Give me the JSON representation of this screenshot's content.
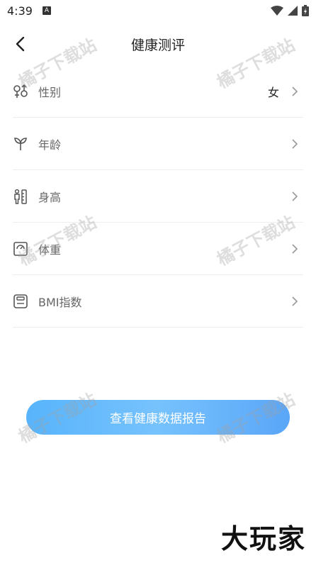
{
  "status_bar": {
    "time": "4:39",
    "app_badge": "A"
  },
  "header": {
    "title": "健康测评"
  },
  "rows": [
    {
      "label": "性别",
      "value": "女",
      "icon": "gender-icon"
    },
    {
      "label": "年龄",
      "value": "",
      "icon": "sprout-icon"
    },
    {
      "label": "身高",
      "value": "",
      "icon": "height-icon"
    },
    {
      "label": "体重",
      "value": "",
      "icon": "scale-icon"
    },
    {
      "label": "BMI指数",
      "value": "",
      "icon": "bmi-icon"
    }
  ],
  "report_button": {
    "label": "查看健康数据报告"
  },
  "watermark": "橘子下载站",
  "brand": "大玩家",
  "colors": {
    "accent": "#62b6fb",
    "icon": "#555555",
    "divider": "#eeeeee"
  }
}
